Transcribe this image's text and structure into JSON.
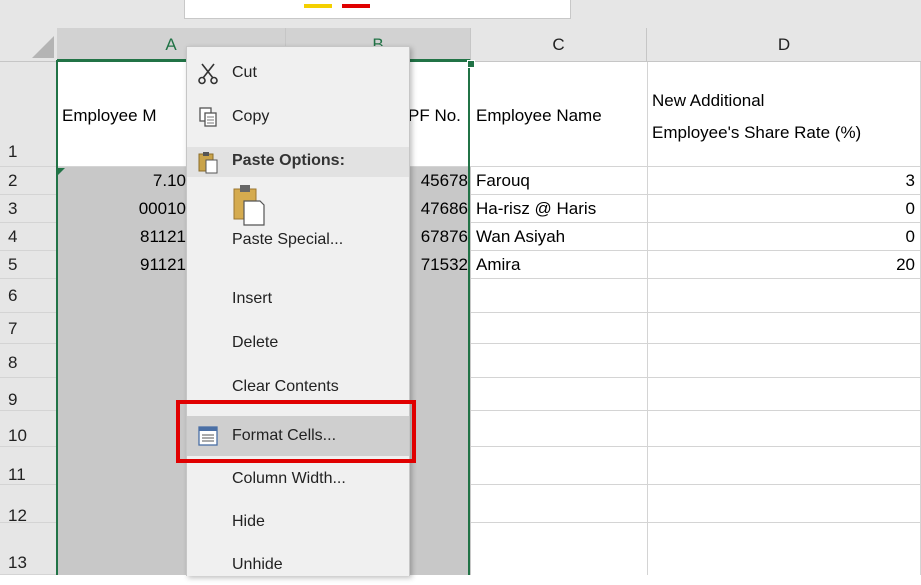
{
  "columns": [
    "A",
    "B",
    "C",
    "D"
  ],
  "rows": [
    "1",
    "2",
    "3",
    "4",
    "5",
    "6",
    "7",
    "8",
    "9",
    "10",
    "11",
    "12",
    "13"
  ],
  "headers": {
    "a1": "Employee M",
    "b1": "PF No.",
    "c1": "Employee Name",
    "d1_line1": "New Additional",
    "d1_line2": "Employee's Share Rate (%)"
  },
  "data_rows": [
    {
      "a": "7.10",
      "b": "45678",
      "c": "Farouq",
      "d": "3"
    },
    {
      "a": "00010",
      "b": "47686",
      "c": "Ha-risz @ Haris",
      "d": "0"
    },
    {
      "a": "81121",
      "b": "67876",
      "c": "Wan Asiyah",
      "d": "0"
    },
    {
      "a": "91121",
      "b": "71532",
      "c": "Amira",
      "d": "20"
    }
  ],
  "context_menu": {
    "cut": "Cut",
    "copy": "Copy",
    "paste_options": "Paste Options:",
    "paste_special": "Paste Special...",
    "insert": "Insert",
    "delete": "Delete",
    "clear_contents": "Clear Contents",
    "format_cells": "Format Cells...",
    "column_width": "Column Width...",
    "hide": "Hide",
    "unhide": "Unhide"
  },
  "colors": {
    "selection_green": "#217346",
    "highlight_red": "#e00000"
  }
}
